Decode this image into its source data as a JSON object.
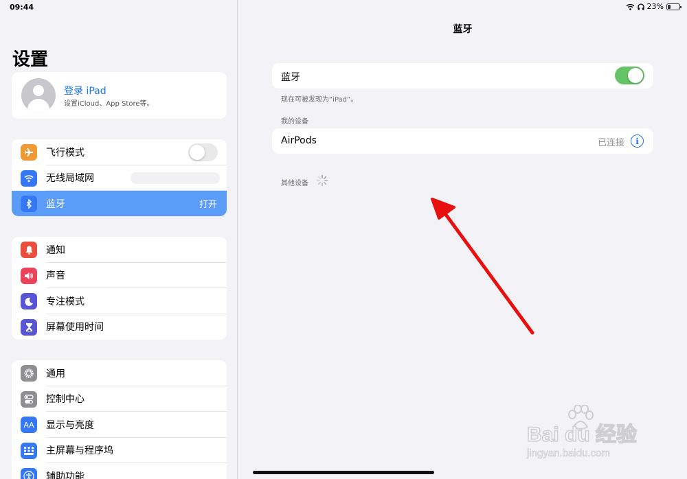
{
  "status": {
    "time": "09:44",
    "battery": "23%"
  },
  "sidebar": {
    "title": "设置",
    "profile": {
      "name": "登录 iPad",
      "subtitle": "设置iCloud、App Store等。"
    },
    "group1": [
      {
        "label": "飞行模式",
        "icon": "airplane-icon",
        "color": "#f09a37",
        "toggle": false
      },
      {
        "label": "无线局域网",
        "icon": "wifi-icon",
        "color": "#3478f6"
      },
      {
        "label": "蓝牙",
        "icon": "bluetooth-icon",
        "color": "#3478f6",
        "value": "打开",
        "selected": true
      }
    ],
    "group2": [
      {
        "label": "通知",
        "icon": "bell-icon",
        "color": "#eb4e3d"
      },
      {
        "label": "声音",
        "icon": "speaker-icon",
        "color": "#eb445a"
      },
      {
        "label": "专注模式",
        "icon": "moon-icon",
        "color": "#5856d6"
      },
      {
        "label": "屏幕使用时间",
        "icon": "hourglass-icon",
        "color": "#5856d6"
      }
    ],
    "group3": [
      {
        "label": "通用",
        "icon": "gear-icon",
        "color": "#8e8e93"
      },
      {
        "label": "控制中心",
        "icon": "switches-icon",
        "color": "#8e8e93"
      },
      {
        "label": "显示与亮度",
        "icon": "text-size-icon",
        "color": "#3478f6"
      },
      {
        "label": "主屏幕与程序坞",
        "icon": "home-grid-icon",
        "color": "#3478f6"
      },
      {
        "label": "辅助功能",
        "icon": "accessibility-icon",
        "color": "#3478f6"
      }
    ]
  },
  "main": {
    "title": "蓝牙",
    "bluetooth_label": "蓝牙",
    "bluetooth_on": true,
    "discoverable_text": "现在可被发现为“iPad”。",
    "my_devices_header": "我的设备",
    "device": {
      "name": "AirPods",
      "status": "已连接"
    },
    "other_devices_header": "其他设备"
  },
  "watermark": {
    "brand": "Bai du 经验",
    "url": "jingyan.baidu.com"
  }
}
